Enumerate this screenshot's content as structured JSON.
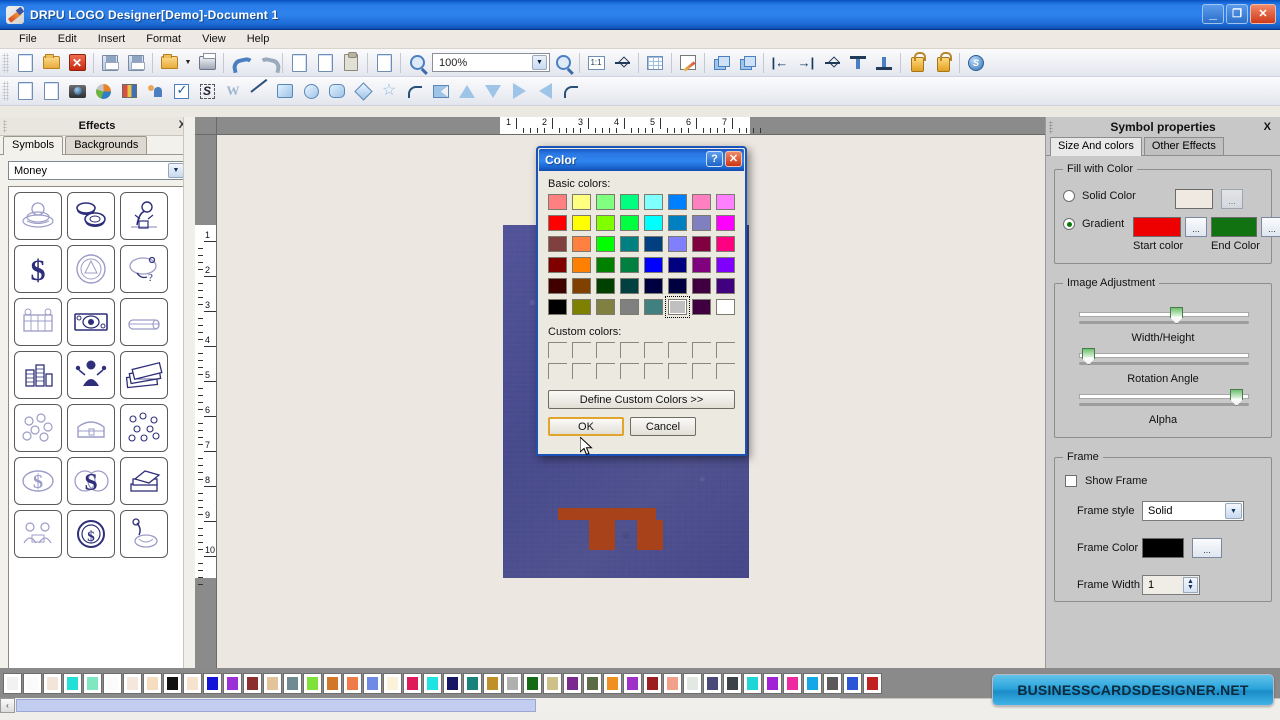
{
  "window": {
    "title": "DRPU LOGO Designer[Demo]-Document 1",
    "icon": "app-logo-icon",
    "controls": {
      "minimize": "_",
      "restore": "❐",
      "close": "✕"
    }
  },
  "menubar": {
    "items": [
      "File",
      "Edit",
      "Insert",
      "Format",
      "View",
      "Help"
    ]
  },
  "toolbar_main": {
    "zoom_value": "100%",
    "buttons": [
      {
        "name": "new-document",
        "icon": "doc"
      },
      {
        "name": "open-file",
        "icon": "folder"
      },
      {
        "name": "close-document",
        "icon": "redx"
      },
      {
        "name": "save",
        "icon": "floppy"
      },
      {
        "name": "save-as",
        "icon": "floppy2"
      },
      {
        "name": "open-recent",
        "icon": "folder-arrow"
      },
      {
        "name": "print",
        "icon": "printer"
      },
      {
        "name": "undo",
        "icon": "undo"
      },
      {
        "name": "redo",
        "icon": "redo"
      },
      {
        "name": "cut",
        "icon": "cut-doc"
      },
      {
        "name": "copy",
        "icon": "copy"
      },
      {
        "name": "paste",
        "icon": "clipboard"
      },
      {
        "name": "delete",
        "icon": "delete-doc"
      },
      {
        "name": "zoom-in",
        "icon": "magnifier-plus"
      },
      {
        "name": "zoom-out",
        "icon": "magnifier-minus"
      },
      {
        "name": "actual-size",
        "icon": "one-to-one"
      },
      {
        "name": "fit-to-window",
        "icon": "fit"
      },
      {
        "name": "show-grid",
        "icon": "grid"
      },
      {
        "name": "design-tools",
        "icon": "pen"
      },
      {
        "name": "bring-to-front",
        "icon": "layer-front"
      },
      {
        "name": "send-to-back",
        "icon": "layer-back"
      },
      {
        "name": "align-left",
        "icon": "align-left"
      },
      {
        "name": "align-right",
        "icon": "align-right"
      },
      {
        "name": "align-center",
        "icon": "align-center"
      },
      {
        "name": "align-top",
        "icon": "align-top"
      },
      {
        "name": "align-bottom",
        "icon": "align-bottom"
      },
      {
        "name": "lock",
        "icon": "lock-closed"
      },
      {
        "name": "unlock",
        "icon": "lock-open"
      },
      {
        "name": "about",
        "icon": "globe"
      }
    ]
  },
  "toolbar_shapes": {
    "buttons": [
      {
        "name": "add-page",
        "icon": "page-add"
      },
      {
        "name": "add-image",
        "icon": "image-add"
      },
      {
        "name": "capture",
        "icon": "camera"
      },
      {
        "name": "color-wheel",
        "icon": "pie"
      },
      {
        "name": "library",
        "icon": "books"
      },
      {
        "name": "contacts",
        "icon": "people"
      },
      {
        "name": "checkbox-tool",
        "icon": "checkbox"
      },
      {
        "name": "signature-tool",
        "icon": "signature"
      },
      {
        "name": "watermark-tool",
        "icon": "watermark"
      },
      {
        "name": "line-tool",
        "icon": "line"
      },
      {
        "name": "rectangle-tool",
        "icon": "rectangle"
      },
      {
        "name": "ellipse-tool",
        "icon": "ellipse"
      },
      {
        "name": "rounded-rect-tool",
        "icon": "rounded-rect"
      },
      {
        "name": "diamond-tool",
        "icon": "diamond"
      },
      {
        "name": "star-tool",
        "icon": "star"
      },
      {
        "name": "arc-tool",
        "icon": "arc"
      },
      {
        "name": "bowtie-tool",
        "icon": "bowtie"
      },
      {
        "name": "triangle-up-tool",
        "icon": "triangle-up"
      },
      {
        "name": "triangle-down-tool",
        "icon": "triangle-down"
      },
      {
        "name": "triangle-right-tool",
        "icon": "triangle-right"
      },
      {
        "name": "triangle-left-tool",
        "icon": "triangle-left"
      },
      {
        "name": "curve-tool",
        "icon": "curve"
      }
    ]
  },
  "left_panel": {
    "title": "Effects",
    "close": "X",
    "tabs": [
      {
        "label": "Symbols",
        "active": true
      },
      {
        "label": "Backgrounds",
        "active": false
      }
    ],
    "category": "Money",
    "symbols": [
      "coins-pile",
      "stacked-coins",
      "money-bag-tree",
      "dollar-sign",
      "seal-coin",
      "money-spill",
      "cash-register",
      "banknote",
      "money-roll",
      "coin-stacks",
      "money-person",
      "fanned-bills",
      "scattered-coins",
      "treasure-chest",
      "coins-confetti",
      "dollar-outline",
      "dollar-coins",
      "bill-stacks",
      "people-money",
      "engraved-coin",
      "coin-drop"
    ]
  },
  "rulers": {
    "horizontal_ticks": [
      "1",
      "2",
      "3",
      "4",
      "5",
      "6",
      "7"
    ],
    "vertical_ticks": [
      "1",
      "2",
      "3",
      "4",
      "5",
      "6",
      "7",
      "8",
      "9",
      "10"
    ]
  },
  "canvas": {
    "artboard_fill": "#4d4f90",
    "accent_shape_color": "#a8421a"
  },
  "dialog": {
    "title": "Color",
    "help_btn": "?",
    "close_btn": "✕",
    "basic_colors_label": "Basic colors:",
    "custom_colors_label": "Custom colors:",
    "define_custom_label": "Define Custom Colors >>",
    "ok_label": "OK",
    "cancel_label": "Cancel",
    "selected_index": 45,
    "basic_colors": [
      "#ff8080",
      "#ffff80",
      "#80ff80",
      "#00ff80",
      "#80ffff",
      "#0080ff",
      "#ff80c0",
      "#ff80ff",
      "#ff0000",
      "#ffff00",
      "#80ff00",
      "#00ff40",
      "#00ffff",
      "#0080c0",
      "#8080c0",
      "#ff00ff",
      "#804040",
      "#ff8040",
      "#00ff00",
      "#008080",
      "#004080",
      "#8080ff",
      "#800040",
      "#ff0080",
      "#800000",
      "#ff8000",
      "#008000",
      "#008040",
      "#0000ff",
      "#000080",
      "#800080",
      "#8000ff",
      "#400000",
      "#804000",
      "#004000",
      "#004040",
      "#000040",
      "#000040",
      "#400040",
      "#400080",
      "#000000",
      "#808000",
      "#808040",
      "#808080",
      "#408080",
      "#c0c0c0",
      "#400040",
      "#ffffff"
    ],
    "custom_slots": 16
  },
  "right_panel": {
    "title": "Symbol properties",
    "close": "X",
    "tabs": [
      {
        "label": "Size And colors",
        "active": true
      },
      {
        "label": "Other Effects",
        "active": false
      }
    ],
    "fill_group": {
      "legend": "Fill with Color",
      "solid_label": "Solid Color",
      "solid_selected": false,
      "solid_swatch": "#efe9e2",
      "gradient_label": "Gradient",
      "gradient_selected": true,
      "start_color": "#ee0000",
      "end_color": "#107210",
      "start_caption": "Start color",
      "end_caption": "End Color",
      "browse_label": "..."
    },
    "image_adjustment": {
      "legend": "Image Adjustment",
      "sliders": [
        {
          "label": "Width/Height",
          "value_pct": 58
        },
        {
          "label": "Rotation Angle",
          "value_pct": 2
        },
        {
          "label": "Alpha",
          "value_pct": 96
        }
      ]
    },
    "frame_group": {
      "legend": "Frame",
      "show_frame_label": "Show Frame",
      "show_frame_checked": false,
      "frame_style_label": "Frame style",
      "frame_style_value": "Solid",
      "frame_color_label": "Frame Color",
      "frame_color_value": "#000000",
      "frame_width_label": "Frame Width",
      "frame_width_value": "1",
      "browse_label": "..."
    }
  },
  "bottom_palette": {
    "colors": [
      "#f2f2f2",
      "#fbfbfb",
      "#f3e6d8",
      "#22e0d8",
      "#7fe8c0",
      "#fbfbfb",
      "#f5e7db",
      "#f7ddc0",
      "#111111",
      "#f7e3cd",
      "#1414d8",
      "#9b30d8",
      "#8e2f2f",
      "#e3c49a",
      "#6f8a93",
      "#7ee23a",
      "#d2762a",
      "#ef7a4a",
      "#6f8ae6",
      "#fbf2da",
      "#e01a58",
      "#1fe4e4",
      "#171766",
      "#17837a",
      "#c08f2a",
      "#b0b0b0",
      "#156b15",
      "#cfc08a",
      "#7a2a8f",
      "#5a6b45",
      "#f09020",
      "#a031c8",
      "#9b1f1f",
      "#f2a08a",
      "#e2e8e2",
      "#4a4a78",
      "#3d4248",
      "#1fd6d6",
      "#a021d6",
      "#ef2aa0",
      "#15a8e8",
      "#5a5a5a",
      "#2a55d6",
      "#c02222"
    ]
  },
  "statusbar": {
    "scroll_left_arrow": "‹"
  },
  "brand": {
    "label": "BUSINESSCARDSDESIGNER.NET"
  }
}
